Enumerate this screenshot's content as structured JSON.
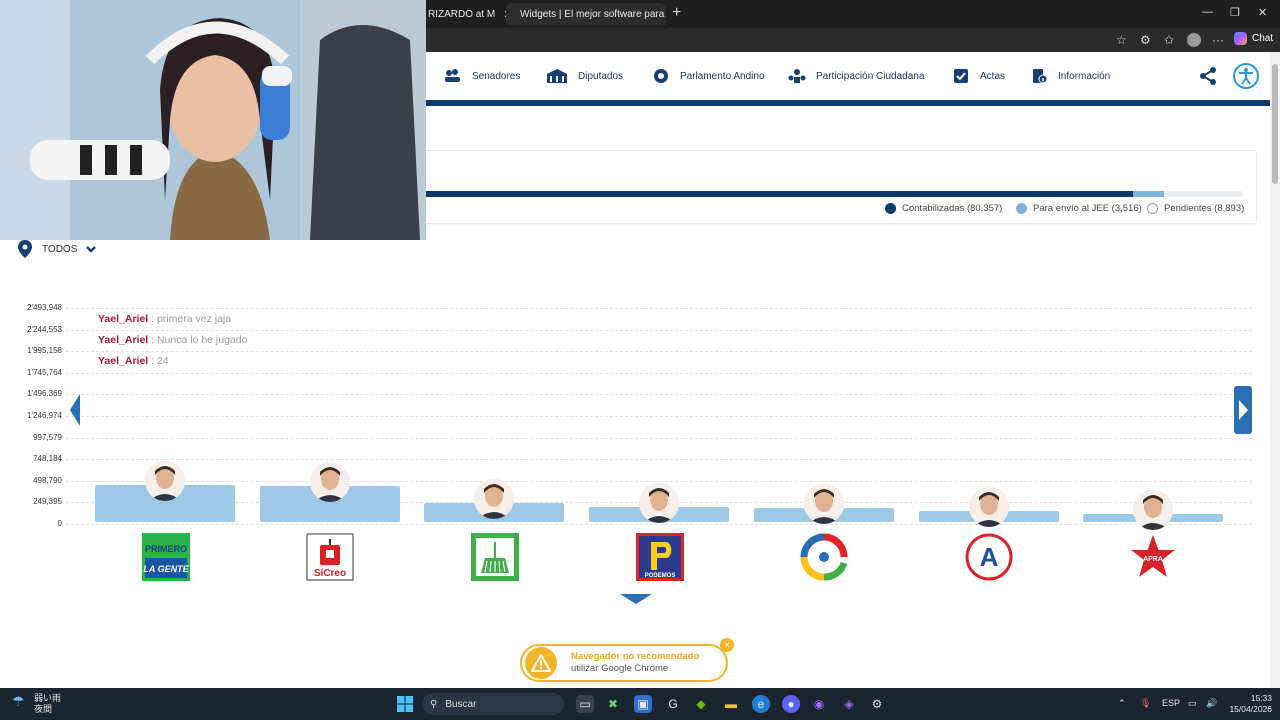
{
  "browser": {
    "tabs": [
      {
        "title": "RIZARDO at M"
      },
      {
        "title": "Widgets | El mejor software para p"
      }
    ],
    "new_tab": "+",
    "chat_label": "Chat"
  },
  "site_nav": {
    "items": [
      {
        "label": "Senadores",
        "icon": "senate-icon"
      },
      {
        "label": "Diputados",
        "icon": "deputies-icon"
      },
      {
        "label": "Parlamento Andino",
        "icon": "andean-parliament-icon"
      },
      {
        "label": "Participación Ciudadana",
        "icon": "citizen-participation-icon"
      },
      {
        "label": "Actas",
        "icon": "checklist-icon"
      },
      {
        "label": "Información",
        "icon": "info-document-icon"
      }
    ],
    "accent": "#0e3a6b"
  },
  "progress": {
    "legend": [
      {
        "label": "Contabilizadas (80,357)",
        "color": "#0e3a6b"
      },
      {
        "label": "Para envío al JEE (3,516)",
        "color": "#7fb2de"
      },
      {
        "label": "Pendientes (8,893)",
        "color": "#ffffff"
      }
    ],
    "contabilizadas": 80357,
    "para_envio_jee": 3516,
    "pendientes": 8893
  },
  "filter": {
    "label": "TODOS"
  },
  "chat_overlay": [
    {
      "user": "Yael_Ariel",
      "sep": ":",
      "message": "primera vez jaja"
    },
    {
      "user": "Yael_Ariel",
      "sep": ":",
      "message": "Nunca lo he jugado"
    },
    {
      "user": "Yael_Ariel",
      "sep": ":",
      "message": "24"
    }
  ],
  "chart_data": {
    "type": "bar",
    "title": "",
    "xlabel": "",
    "ylabel": "",
    "ylim": [
      0,
      2493948
    ],
    "y_ticks": [
      "2'493,948",
      "2'244,553",
      "1'995,158",
      "1'745,764",
      "1'496,369",
      "1'246,974",
      "997,579",
      "748,184",
      "498,790",
      "249,395",
      "0"
    ],
    "y_tick_values": [
      2493948,
      2244553,
      1995158,
      1745764,
      1496369,
      1246974,
      997579,
      748184,
      498790,
      249395,
      0
    ],
    "categories": [
      "PRIMERO LA GENTE",
      "SíCreo",
      "broom party",
      "PODEMOS",
      "circle C party",
      "A party",
      "star party"
    ],
    "values": [
      455000,
      440000,
      245000,
      200000,
      190000,
      145000,
      120000
    ],
    "bar_color": "#9dc8e6",
    "grid": true
  },
  "party_logos": [
    {
      "text_line1": "PRIMERO",
      "text_line2": "LA GENTE"
    },
    {
      "text": "SíCreo"
    },
    {
      "text": ""
    },
    {
      "text": "PODEMOS"
    },
    {
      "text": ""
    },
    {
      "text": "A"
    },
    {
      "text": "APRA"
    }
  ],
  "toast": {
    "title": "Navegador no recomendado",
    "body": "utilizar Google Chrome",
    "close": "×"
  },
  "taskbar": {
    "weather_line1": "弱い雨",
    "weather_line2": "夜間",
    "search_placeholder": "Buscar",
    "language": "ESP",
    "time": "15:33",
    "date": "15/04/2026"
  }
}
